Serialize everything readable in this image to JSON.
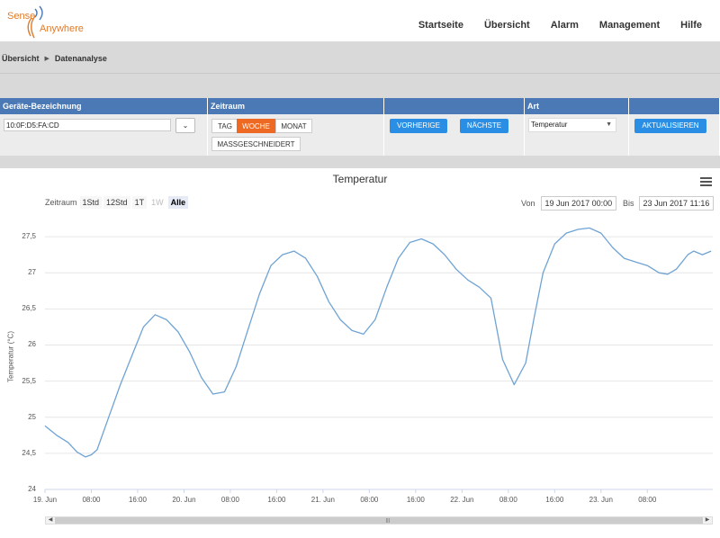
{
  "brand": {
    "line1": "Sense",
    "line2": "Anywhere",
    "color": "#e07b2a"
  },
  "nav": [
    "Startseite",
    "Übersicht",
    "Alarm",
    "Management",
    "Hilfe"
  ],
  "breadcrumb": [
    "Übersicht",
    "Datenanalyse"
  ],
  "filter": {
    "headers": [
      "Geräte-Bezeichnung",
      "Zeitraum",
      "",
      "Art",
      ""
    ],
    "device_value": "10:0F:D5:FA:CD",
    "periods": [
      "TAG",
      "WOCHE",
      "MONAT",
      "MASSGESCHNEIDERT"
    ],
    "active_period": "WOCHE",
    "prev_label": "VORHERIGE",
    "next_label": "NÄCHSTE",
    "art_value": "Temperatur",
    "refresh_label": "AKTUALISIEREN",
    "header_color": "#4a79b5",
    "accent_color": "#ee6a24",
    "button_color": "#2a8fe4"
  },
  "chart_controls": {
    "zoom_label": "Zeitraum",
    "zoom_buttons": [
      "1Std",
      "12Std",
      "1T",
      "1W",
      "Alle"
    ],
    "disabled": "1W",
    "selected": "Alle",
    "from_label": "Von",
    "from_value": "19 Jun 2017 00:00",
    "to_label": "Bis",
    "to_value": "23 Jun 2017 11:16"
  },
  "chart_data": {
    "type": "line",
    "title": "Temperatur",
    "ylabel": "Temperatur (°C)",
    "xlabel": "",
    "ylim": [
      24,
      27.75
    ],
    "y_ticks": [
      "24",
      "24,5",
      "25",
      "25,5",
      "26",
      "26,5",
      "27",
      "27,5"
    ],
    "x_ticks": [
      "19. Jun",
      "08:00",
      "16:00",
      "20. Jun",
      "08:00",
      "16:00",
      "21. Jun",
      "08:00",
      "16:00",
      "22. Jun",
      "08:00",
      "16:00",
      "23. Jun",
      "08:00"
    ],
    "x_unit": "hours since 19 Jun 2017 00:00",
    "grid": true,
    "line_color": "#6fa3d4",
    "series": [
      {
        "name": "",
        "x": [
          0,
          2,
          4,
          5.5,
          7,
          8,
          9,
          11,
          13,
          15,
          17,
          19,
          21,
          23,
          25,
          27,
          29,
          31,
          33,
          35,
          37,
          39,
          41,
          43,
          45,
          47,
          49,
          51,
          53,
          55,
          57,
          59,
          61,
          63,
          65,
          67,
          69,
          71,
          73,
          75,
          77,
          79,
          81,
          83,
          84.5,
          86,
          88,
          90,
          92,
          94,
          96,
          98,
          100,
          102,
          104,
          106,
          107.5,
          109,
          111,
          112,
          113.5,
          115
        ],
        "y": [
          24.88,
          24.75,
          24.65,
          24.52,
          24.45,
          24.48,
          24.55,
          25.0,
          25.45,
          25.85,
          26.25,
          26.42,
          26.35,
          26.18,
          25.9,
          25.55,
          25.32,
          25.35,
          25.7,
          26.2,
          26.7,
          27.1,
          27.25,
          27.3,
          27.2,
          26.95,
          26.6,
          26.35,
          26.2,
          26.15,
          26.35,
          26.8,
          27.2,
          27.42,
          27.47,
          27.4,
          27.25,
          27.05,
          26.9,
          26.8,
          26.65,
          25.8,
          25.45,
          25.75,
          26.4,
          27.0,
          27.4,
          27.55,
          27.6,
          27.62,
          27.55,
          27.35,
          27.2,
          27.15,
          27.1,
          27.0,
          26.98,
          27.05,
          27.25,
          27.3,
          27.25,
          27.3
        ]
      }
    ]
  }
}
